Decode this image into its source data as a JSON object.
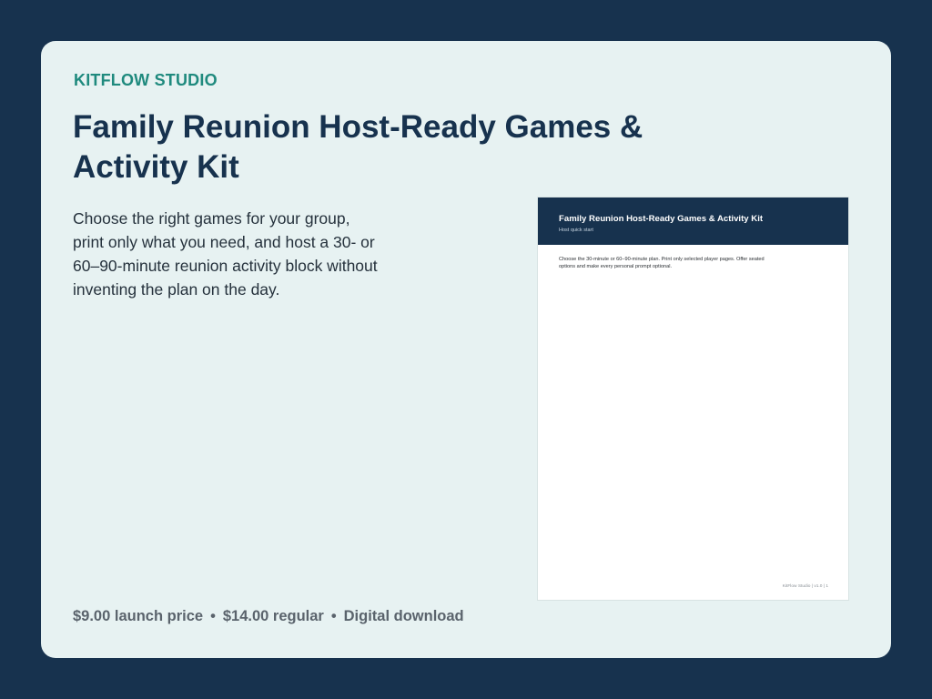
{
  "brand": "KITFLOW STUDIO",
  "title": "Family Reunion Host-Ready Games & Activity Kit",
  "description": "Choose the right games for your group, print only what you need, and host a 30- or 60–90-minute reunion activity block without inventing the plan on the day.",
  "pricing": {
    "launch": "$9.00 launch price",
    "regular": "$14.00 regular",
    "format": "Digital download",
    "separator": "•"
  },
  "preview": {
    "title": "Family Reunion Host-Ready Games & Activity Kit",
    "subtitle": "Host quick start",
    "body": "Choose the 30-minute or 60–90-minute plan. Print only selected player pages. Offer seated options and make every personal prompt optional.",
    "footer": "KitFlow Studio | v1.0 | 1"
  },
  "colors": {
    "background": "#17324e",
    "card": "#e7f2f2",
    "accent": "#1f8a7e",
    "title": "#17324e"
  }
}
